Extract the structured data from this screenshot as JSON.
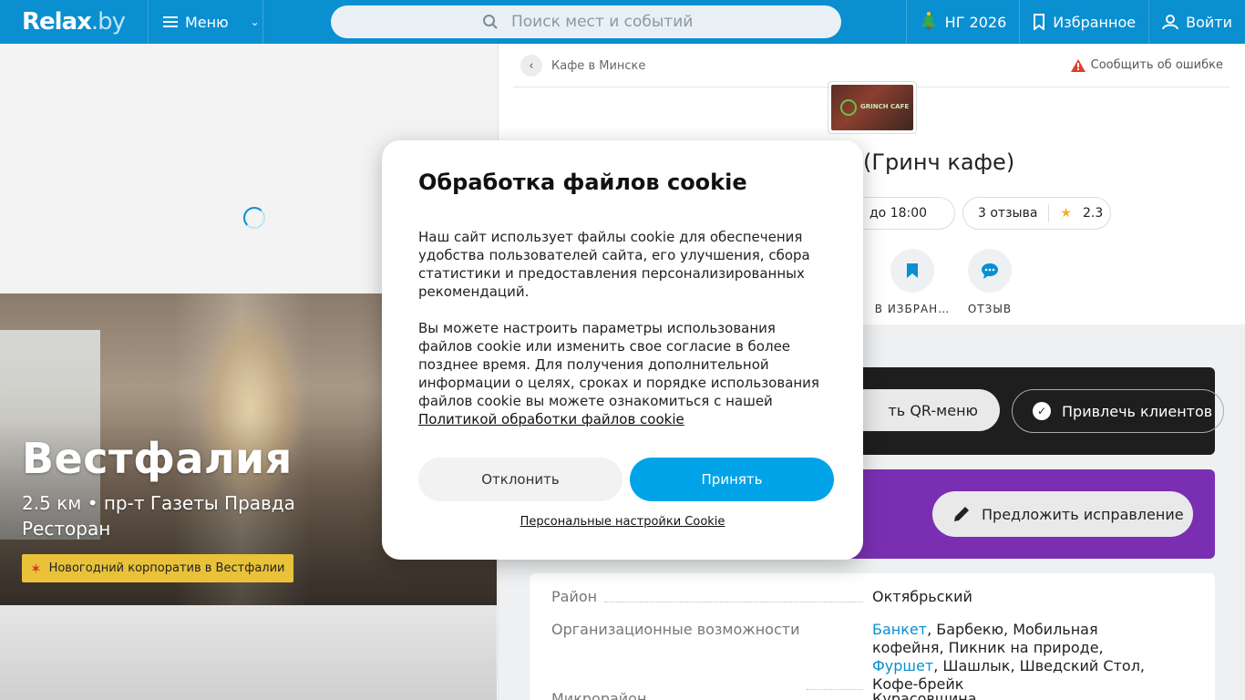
{
  "header": {
    "logo_main": "Relax",
    "logo_suffix": ".by",
    "menu_label": "Меню",
    "search_placeholder": "Поиск мест и событий",
    "ng_label": "НГ 2026",
    "favorites_label": "Избранное",
    "login_label": "Войти"
  },
  "promo": {
    "name": "Вестфалия",
    "subtitle": "2.5 км • пр-т Газеты Правда",
    "type": "Ресторан",
    "badge": "Новогодний корпоратив в Вестфалии"
  },
  "place": {
    "breadcrumb": "Кафе в Минске",
    "report_label": "Сообщить об ошибке",
    "title_visible": "(Гринч кафе)",
    "thumb_sign": "GRINCH CAFE",
    "hours": "до 18:00",
    "reviews": "3 отзыва",
    "rating": "2.3",
    "actions": [
      {
        "label": "В ИЗБРАН…",
        "icon": "bookmark-icon"
      },
      {
        "label": "ОТЗЫВ",
        "icon": "chat-icon"
      }
    ],
    "qr_label": "ть QR-меню",
    "attract_label": "Привлечь клиентов",
    "suggest_label": "Предложить исправление",
    "info": {
      "district_key": "Район",
      "district_val": "Октябрьский",
      "org_key": "Организационные возможности",
      "org_link1": "Банкет",
      "org_text1": ", Барбекю, Мобильная кофейня, Пикник на природе, ",
      "org_link2": "Фуршет",
      "org_text2": ", Шашлык, Шведский Стол, Кофе-брейк",
      "micro_key": "Микрорайон",
      "micro_val": "Курасовщина"
    }
  },
  "cookie_modal": {
    "title": "Обработка файлов cookie",
    "paragraph1": "Наш сайт использует файлы cookie для обеспечения удобства пользователей сайта, его улучшения, сбора статистики и предоставления персонализированных рекомендаций.",
    "paragraph2": "Вы можете настроить параметры использования файлов cookie или изменить свое согласие в более позднее время. Для получения дополнительной информации о целях, сроках и порядке использования файлов cookie вы можете ознакомиться с нашей",
    "policy_link": "Политикой обработки файлов cookie",
    "decline_label": "Отклонить",
    "accept_label": "Принять",
    "personal_settings_label": "Персональные настройки Cookie"
  },
  "colors": {
    "header_bg": "#0a8fd1",
    "accept_bg": "#00a3e8",
    "purple_banner": "#7a2fb3",
    "dark_banner": "#1e1e1e",
    "badge_bg": "#e9c23a"
  }
}
